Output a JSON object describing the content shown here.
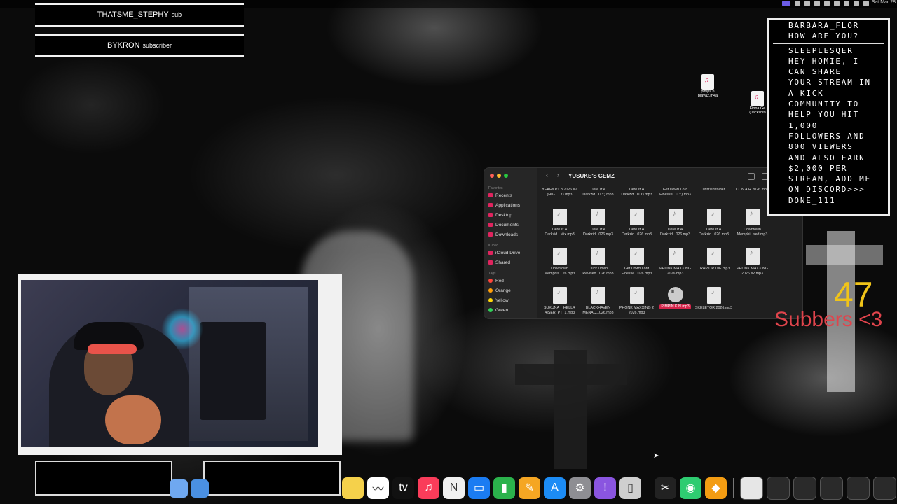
{
  "menubar": {
    "clock": "Sat Mar 28"
  },
  "banner": {
    "row1_name": "THATSME_STEPHY",
    "row1_suffix": "SUB",
    "row2_name": "BYKRON",
    "row2_suffix": "SUBSCRIBER"
  },
  "chat": {
    "lines": [
      "BARBARA_FLOR",
      "HOW ARE YOU?",
      "SLEEPLESQER",
      "HEY HOMIE, I",
      "CAN SHARE",
      "YOUR STREAM IN",
      "A KICK",
      "COMMUNITY TO",
      "HELP YOU HIT",
      "1,000",
      "FOLLOWERS AND",
      "800 VIEWERS",
      "AND ALSO EARN",
      "$2,000 PER",
      "STREAM, ADD ME",
      "ON DISCORD>>>",
      "DONE_111"
    ]
  },
  "desktop_files": [
    {
      "name": "pimps n playaz.m4a"
    },
    {
      "name": "Finna Ge (Jackshit)"
    }
  ],
  "finder": {
    "title": "YUSUKE'S GEMZ",
    "sidebar": {
      "favorites_label": "Favorites",
      "favorites": [
        "Recents",
        "Applications",
        "Desktop",
        "Documents",
        "Downloads"
      ],
      "icloud_label": "iCloud",
      "icloud": [
        "iCloud Drive",
        "Shared"
      ],
      "tags_label": "Tags",
      "tags": [
        {
          "name": "Red",
          "color": "#ff453a"
        },
        {
          "name": "Orange",
          "color": "#ff9f0a"
        },
        {
          "name": "Yellow",
          "color": "#ffd60a"
        },
        {
          "name": "Green",
          "color": "#30d158"
        }
      ]
    },
    "files": [
      [
        "YEAHs PT 3 2026 #2 (HIG...TY).mp3",
        "Dere iz A Darkzid...ITY).mp3",
        "Dere iz A Darkzid...ITY).mp3",
        "Get Down Lord Finesse...ITY).mp3",
        "untitled folder",
        "CON AIR 2026.mp3"
      ],
      [
        "Dere iz A Darkzid...Mix.mp3",
        "Dere iz A Darkzid...026.mp3",
        "Dere iz A Darkzid...026.mp3",
        "Dere iz A Darkzid...026.mp3",
        "Dere iz A Darkzid...026.mp3",
        "Downtown Memphi...sed.mp3"
      ],
      [
        "Downtown Memphis...26.mp3",
        "Duck Down Revised...026.mp3",
        "Get Down Lord Finesse...026.mp3",
        "PHONK MAXXING 2026.mp3",
        "TRAP OR DIE.mp3",
        "PHONK MAXXING 2026 #2.mp3"
      ],
      [
        "SUKUNA__HELLR AISER_PT_1.mp3",
        "BLACKHAVEN MENAC...026.mp3",
        "PHONK MAXXING 2 2026.mp3",
        "PIMPIN KIN.mp3",
        "SKELETOR 2026.mp3"
      ]
    ],
    "selected_file": "PIMPIN KIN.mp3"
  },
  "sub_counter": {
    "count": "47",
    "label": "Subbers <3"
  },
  "dock": {
    "apps": [
      {
        "name": "notes",
        "color": "#f5d14b",
        "glyph": ""
      },
      {
        "name": "freeform",
        "color": "#ffffff",
        "glyph": "〰"
      },
      {
        "name": "apple-tv",
        "color": "#111111",
        "glyph": "tv"
      },
      {
        "name": "music",
        "color": "#fa3c5a",
        "glyph": "♫"
      },
      {
        "name": "news",
        "color": "#f0f0f0",
        "glyph": "N"
      },
      {
        "name": "keynote",
        "color": "#1b7cf2",
        "glyph": "▭"
      },
      {
        "name": "numbers",
        "color": "#2bb24c",
        "glyph": "▮"
      },
      {
        "name": "pages",
        "color": "#f5a623",
        "glyph": "✎"
      },
      {
        "name": "app-store",
        "color": "#1c8cf5",
        "glyph": "A"
      },
      {
        "name": "system-settings",
        "color": "#8e8e93",
        "glyph": "⚙"
      },
      {
        "name": "feedback",
        "color": "#8a55e0",
        "glyph": "!"
      },
      {
        "name": "iphone-mirroring",
        "color": "#cfcfcf",
        "glyph": "▯"
      }
    ],
    "apps2": [
      {
        "name": "final-cut",
        "color": "#222222",
        "glyph": "✂"
      },
      {
        "name": "obs",
        "color": "#2ecc71",
        "glyph": "◉"
      },
      {
        "name": "fl-studio",
        "color": "#f39c12",
        "glyph": "◆"
      }
    ]
  }
}
